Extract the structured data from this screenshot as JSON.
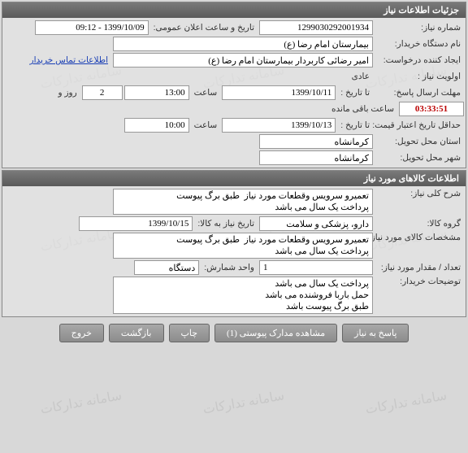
{
  "panel1": {
    "title": "جزئیات اطلاعات نیاز"
  },
  "need_number": {
    "label": "شماره نیاز:",
    "value": "1299030292001934",
    "announce_label": "تاریخ و ساعت اعلان عمومی:",
    "announce_value": "1399/10/09 - 09:12"
  },
  "buyer": {
    "label": "نام دستگاه خریدار:",
    "value": "بیمارستان امام رضا (ع)"
  },
  "creator": {
    "label": "ایجاد کننده درخواست:",
    "value": "امیر رضائی کاربردار بیمارستان امام رضا (ع)",
    "contact_link": "اطلاعات تماس خریدار"
  },
  "priority": {
    "label": "اولویت نیاز :",
    "value": "عادی"
  },
  "deadline": {
    "label": "مهلت ارسال پاسخ:",
    "until_label": "تا تاریخ :",
    "date": "1399/10/11",
    "time_label": "ساعت",
    "time": "13:00",
    "days_value": "2",
    "days_label": "روز و",
    "countdown": "03:33:51",
    "remaining_label": "ساعت باقی مانده"
  },
  "min_validity": {
    "label": "حداقل تاریخ اعتبار قیمت:",
    "until_label": "تا تاریخ :",
    "date": "1399/10/13",
    "time_label": "ساعت",
    "time": "10:00"
  },
  "delivery_province": {
    "label": "استان محل تحویل:",
    "value": "کرمانشاه"
  },
  "delivery_city": {
    "label": "شهر محل تحویل:",
    "value": "کرمانشاه"
  },
  "panel2": {
    "title": "اطلاعات کالاهای مورد نیاز"
  },
  "general_desc": {
    "label": "شرح کلی نیاز:",
    "value": "تعمیرو سرویس وقطعات مورد نیاز  طبق برگ پیوست \nپرداخت یک سال می باشد"
  },
  "group": {
    "label": "گروه کالا:",
    "value": "دارو، پزشکی و سلامت",
    "need_date_label": "تاریخ نیاز به کالا:",
    "need_date_value": "1399/10/15"
  },
  "goods_spec": {
    "label": "مشخصات کالای مورد نیاز:",
    "value": "تعمیرو سرویس وقطعات مورد نیاز  طبق برگ پیوست \nپرداخت یک سال می باشد"
  },
  "quantity": {
    "label": "تعداد / مقدار مورد نیاز:",
    "value": "1",
    "unit_label": "واحد شمارش:",
    "unit_value": "دستگاه"
  },
  "buyer_notes": {
    "label": "توضیحات خریدار:",
    "value": "پرداخت یک سال می باشد\nحمل باربا فروشنده می باشد\nطبق برگ پیوست باشد"
  },
  "buttons": {
    "respond": "پاسخ به نیاز",
    "view_attach": "مشاهده مدارک پیوستی (1)",
    "print": "چاپ",
    "back": "بازگشت",
    "exit": "خروج"
  }
}
